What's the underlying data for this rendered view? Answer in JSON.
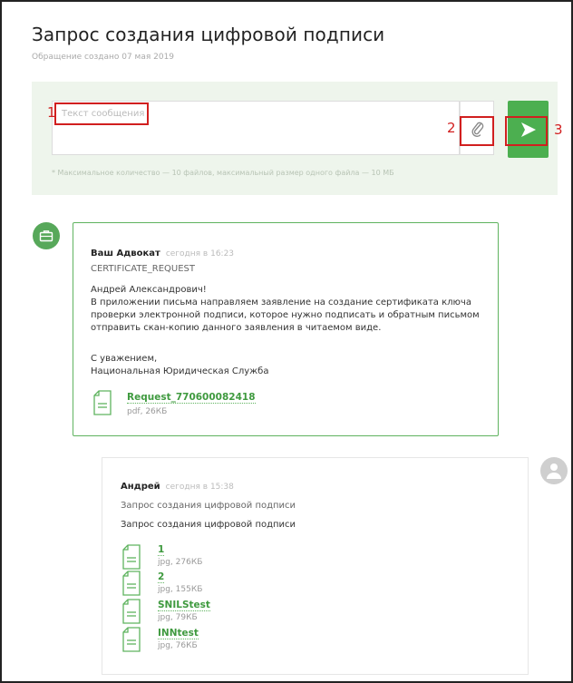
{
  "page": {
    "title": "Запрос создания цифровой подписи",
    "subtitle": "Обращение создано 07 мая 2019"
  },
  "compose": {
    "placeholder": "Текст сообщения",
    "hint": "* Максимальное количество — 10 файлов, максимальный размер одного файла — 10 МБ"
  },
  "annotations": [
    "1",
    "2",
    "3"
  ],
  "messages": [
    {
      "author": "Ваш Адвокат",
      "time": "сегодня в 16:23",
      "subject": "CERTIFICATE_REQUEST",
      "body": [
        "Андрей Александрович!",
        "В приложении письма направляем заявление на создание сертификата ключа",
        "проверки электронной подписи, которое нужно подписать и обратным письмом",
        "отправить скан-копию данного заявления в читаемом виде."
      ],
      "signature": [
        "С уважением,",
        "Национальная Юридическая Служба"
      ],
      "files": [
        {
          "name": "Request_770600082418",
          "meta": "pdf, 26КБ"
        }
      ]
    },
    {
      "author": "Андрей",
      "time": "сегодня в 15:38",
      "subject": "Запрос создания цифровой подписи",
      "text": "Запрос создания цифровой подписи",
      "files": [
        {
          "name": "1",
          "meta": "jpg, 276КБ"
        },
        {
          "name": "2",
          "meta": "jpg, 155КБ"
        },
        {
          "name": "SNILStest",
          "meta": "jpg, 79КБ"
        },
        {
          "name": "INNtest",
          "meta": "jpg, 76КБ"
        }
      ]
    }
  ],
  "colors": {
    "accent": "#4caf50",
    "annotation": "#d11f1f",
    "compose_bg": "#eef5ec"
  },
  "icons": {
    "attach": "paperclip-icon",
    "send": "send-arrow-icon",
    "support_avatar": "briefcase-icon",
    "user_avatar": "user-icon",
    "file": "document-icon"
  }
}
